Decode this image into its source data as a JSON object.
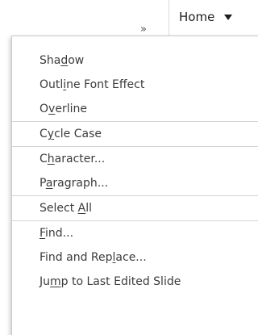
{
  "toolbar": {
    "overflow_glyph": "»",
    "home_tab_label": "Home"
  },
  "menu": {
    "groups": [
      [
        {
          "pre": "Sha",
          "key": "d",
          "post": "ow"
        },
        {
          "pre": "Outl",
          "key": "i",
          "post": "ne Font Effect"
        },
        {
          "pre": "O",
          "key": "v",
          "post": "erline"
        }
      ],
      [
        {
          "pre": "C",
          "key": "y",
          "post": "cle Case"
        }
      ],
      [
        {
          "pre": "C",
          "key": "h",
          "post": "aracter..."
        },
        {
          "pre": "P",
          "key": "a",
          "post": "ragraph..."
        }
      ],
      [
        {
          "pre": "Select ",
          "key": "A",
          "post": "ll"
        }
      ],
      [
        {
          "pre": "",
          "key": "F",
          "post": "ind..."
        },
        {
          "pre": "Find and Rep",
          "key": "l",
          "post": "ace..."
        },
        {
          "pre": "Ju",
          "key": "m",
          "post": "p to Last Edited Slide"
        }
      ]
    ]
  }
}
